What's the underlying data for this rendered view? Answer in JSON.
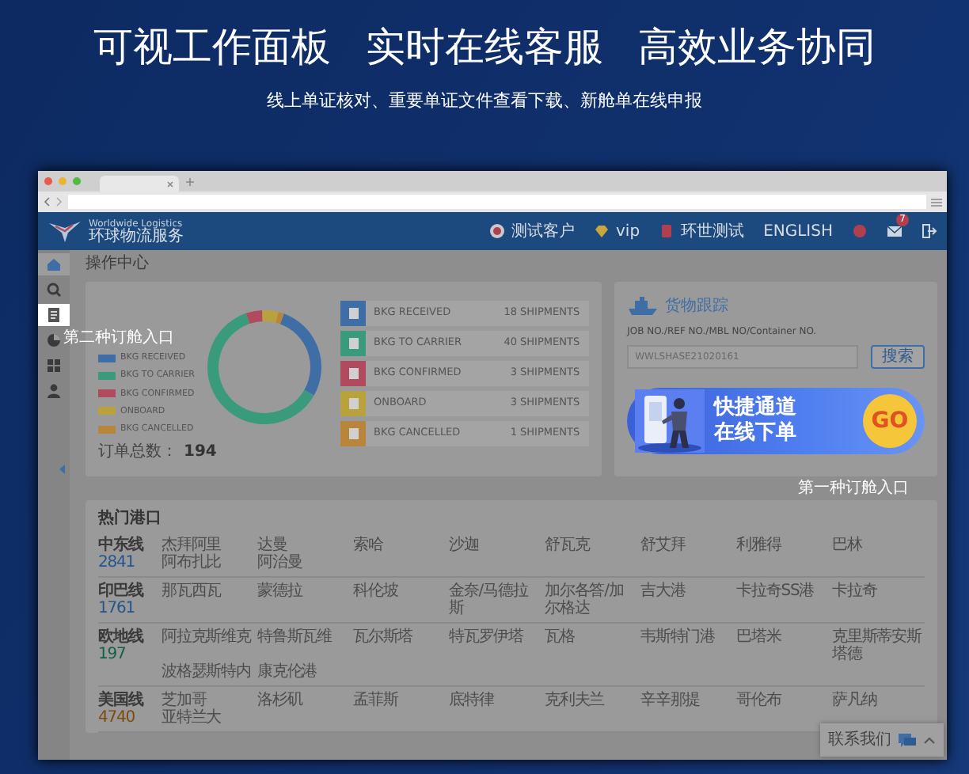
{
  "headlines": [
    "可视工作面板",
    "实时在线客服",
    "高效业务协同"
  ],
  "subtitle": "线上单证核对、重要单证文件查看下载、新舱单在线申报",
  "app": {
    "brand": "Worldwide Logistics",
    "brand_sub": "环球物流服务",
    "header_items": [
      {
        "kind": "customer",
        "label": "测试客户"
      },
      {
        "kind": "vip",
        "label": "vip"
      },
      {
        "kind": "company",
        "label": "环世测试"
      },
      {
        "kind": "language",
        "label": "ENGLISH"
      },
      {
        "kind": "alert"
      },
      {
        "kind": "mail",
        "badge": "7"
      },
      {
        "kind": "logout"
      }
    ],
    "sidebar": [
      {
        "kind": "home",
        "selected": true,
        "highlighted": false
      },
      {
        "kind": "search",
        "selected": false,
        "highlighted": false
      },
      {
        "kind": "orders",
        "selected": false,
        "highlighted": true
      },
      {
        "kind": "chart",
        "selected": false,
        "highlighted": false
      },
      {
        "kind": "grid",
        "selected": false,
        "highlighted": false
      },
      {
        "kind": "user",
        "selected": false,
        "highlighted": false
      }
    ],
    "breadcrumb": "操作中心",
    "bookings": {
      "chart_data": {
        "type": "donut",
        "categories": [
          "BKG RECEIVED",
          "BKG TO CARRIER",
          "BKG CONFIRMED",
          "ONBOARD",
          "BKG CANCELLED"
        ],
        "values": [
          27.7,
          61.5,
          4.6,
          4.6,
          1.6
        ]
      },
      "total_label": "订单总数：",
      "total": "194",
      "statuses": [
        {
          "label": "BKG RECEIVED",
          "count": "18 SHIPMENTS",
          "color": "#3f6ea6"
        },
        {
          "label": "BKG TO CARRIER",
          "count": "40 SHIPMENTS",
          "color": "#3a9a7c"
        },
        {
          "label": "BKG CONFIRMED",
          "count": "3 SHIPMENTS",
          "color": "#b04a5c"
        },
        {
          "label": "ONBOARD",
          "count": "3 SHIPMENTS",
          "color": "#b9a23e"
        },
        {
          "label": "BKG CANCELLED",
          "count": "1 SHIPMENTS",
          "color": "#b9843c"
        }
      ]
    },
    "tracking": {
      "title": "货物跟踪",
      "hint": "JOB NO./REF NO./MBL NO/Container NO.",
      "value": "WWLSHASE21020161",
      "button": "搜索"
    },
    "banner": {
      "lines": [
        "快捷通道",
        "在线下单"
      ],
      "go": "GO"
    },
    "callouts": [
      "第二种订舱入口",
      "第一种订舱入口"
    ],
    "ports": {
      "title": "热门港口",
      "lines": [
        {
          "name": "中东线",
          "count": "2841",
          "color": "#24558c",
          "ports": [
            "杰拜阿里",
            "达曼",
            "索哈",
            "沙迦",
            "舒瓦克",
            "舒艾拜",
            "利雅得",
            "巴林",
            "阿布扎比",
            "阿治曼"
          ]
        },
        {
          "name": "印巴线",
          "count": "1761",
          "color": "#24558c",
          "ports": [
            "那瓦西瓦",
            "蒙德拉",
            "科伦坡",
            "金奈/马德拉斯",
            "加尔各答/加尔格达",
            "吉大港",
            "卡拉奇SS港",
            "卡拉奇"
          ]
        },
        {
          "name": "欧地线",
          "count": "197",
          "color": "#155f47",
          "ports": [
            "阿拉克斯维克",
            "特鲁斯瓦维",
            "瓦尔斯塔",
            "特瓦罗伊塔",
            "瓦格",
            "韦斯特门港",
            "巴塔米",
            "克里斯蒂安斯塔德",
            "波格瑟斯特内",
            "康克伦港"
          ]
        },
        {
          "name": "美国线",
          "count": "4740",
          "color": "#7d4a10",
          "ports": [
            "芝加哥",
            "洛杉矶",
            "孟菲斯",
            "底特律",
            "克利夫兰",
            "辛辛那提",
            "哥伦布",
            "萨凡纳",
            "亚特兰大"
          ]
        }
      ]
    },
    "contact": {
      "label": "联系我们"
    }
  }
}
